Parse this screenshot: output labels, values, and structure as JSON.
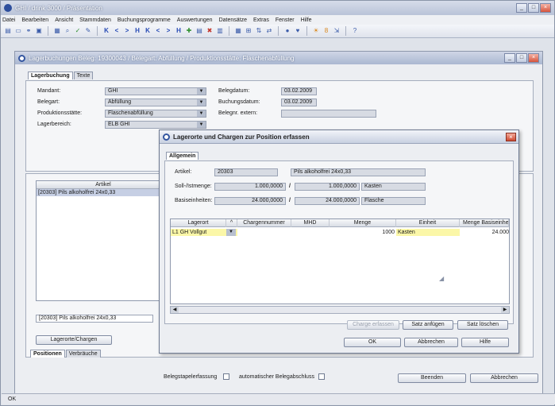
{
  "app": {
    "title": "GHI / drink 3000 / Präsentation",
    "window_controls": [
      "_",
      "□",
      "×"
    ]
  },
  "menu": [
    "Datei",
    "Bearbeiten",
    "Ansicht",
    "Stammdaten",
    "Buchungsprogramme",
    "Auswertungen",
    "Datensätze",
    "Extras",
    "Fenster",
    "Hilfe"
  ],
  "toolbar": {
    "nav": [
      "K",
      "<",
      ">",
      "H",
      "K",
      "<",
      ">",
      "H"
    ]
  },
  "child": {
    "title": "Lagerbuchungen   Beleg: 19300043 / Belegart: Abfüllung / Produktionsstätte: Flaschenabfüllung",
    "tabs": [
      "Lagerbuchung",
      "Texte"
    ],
    "fields": {
      "mandant_label": "Mandant:",
      "mandant_value": "GHI",
      "belegart_label": "Belegart:",
      "belegart_value": "Abfüllung",
      "produktionsstaette_label": "Produktionsstätte:",
      "produktionsstaette_value": "Flaschenabfüllung",
      "lagerbereich_label": "Lagerbereich:",
      "lagerbereich_value": "ELB GHI",
      "belegdatum_label": "Belegdatum:",
      "belegdatum_value": "03.02.2009",
      "buchungsdatum_label": "Buchungsdatum:",
      "buchungsdatum_value": "03.02.2009",
      "belegnr_extern_label": "Belegnr. extern:"
    },
    "artikel_list": {
      "header": "Artikel",
      "rows": [
        "[20303] Pils alkoholfrei 24x0,33"
      ]
    },
    "selected_artikel": "[20303] Pils alkoholfrei 24x0,33",
    "lagerorte_button": "Lagerorte/Chargen",
    "bottom_tabs": [
      "Positionen",
      "Verbräuche"
    ],
    "belegstapel_label": "Belegstapelerfassung",
    "auto_beleg_label": "automatischer Belegabschluss",
    "beenden_button": "Beenden",
    "abbrechen_button": "Abbrechen"
  },
  "dialog": {
    "title": "Lagerorte und Chargen zur Position erfassen",
    "tab": "Allgemein",
    "artikel_label": "Artikel:",
    "artikel_nr": "20303",
    "artikel_name": "Pils alkoholfrei 24x0,33",
    "soll_label": "Soll-/Istmenge:",
    "soll_value": "1.000,0000",
    "ist_value": "1.000,0000",
    "soll_unit": "Kasten",
    "basis_label": "Basiseinheiten:",
    "basis_soll": "24.000,0000",
    "basis_ist": "24.000,0000",
    "basis_unit": "Flasche",
    "slash": "/",
    "grid": {
      "headers": [
        "Lagerort",
        "^",
        "Chargennummer",
        "MHD",
        "Menge",
        "Einheit",
        "Menge Basiseinheit"
      ],
      "row": {
        "lagerort": "L1 GH Vollgut",
        "menge": "1000",
        "einheit": "Kasten",
        "menge_basis": "24.000"
      }
    },
    "buttons": {
      "charge": "Charge erfassen",
      "satz_anfuegen": "Satz anfügen",
      "satz_loeschen": "Satz löschen",
      "ok": "OK",
      "abbrechen": "Abbrechen",
      "hilfe": "Hilfe"
    }
  },
  "status": "OK"
}
